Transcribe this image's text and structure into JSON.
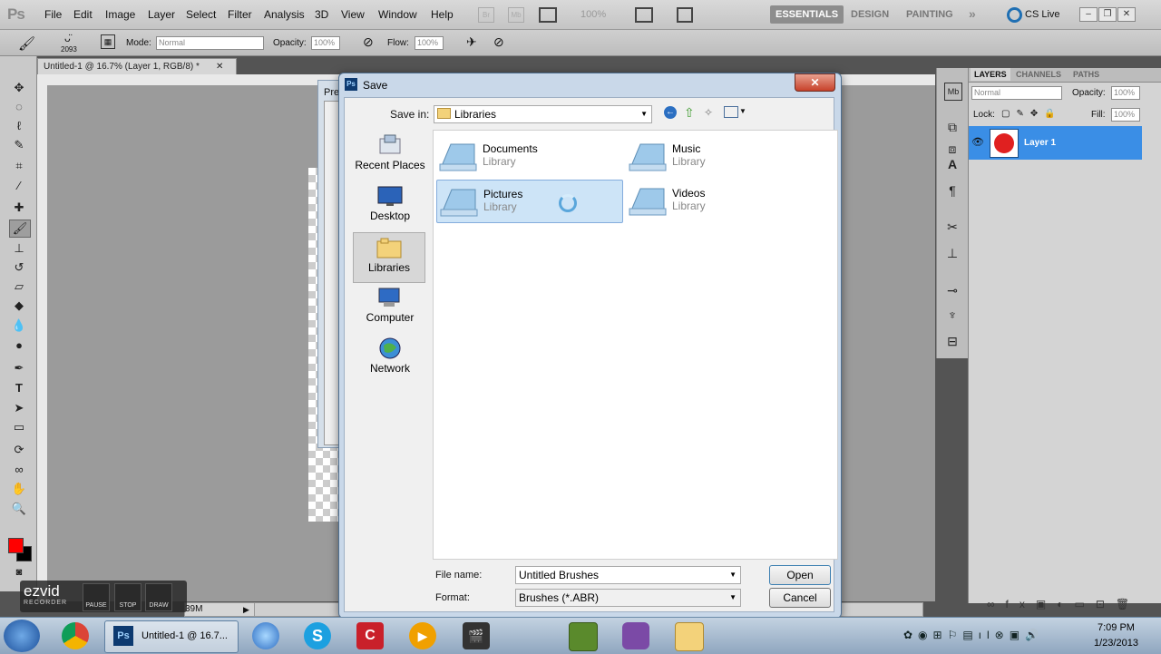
{
  "app": {
    "logo": "Ps",
    "menu": [
      "File",
      "Edit",
      "Image",
      "Layer",
      "Select",
      "Filter",
      "Analysis",
      "3D",
      "View",
      "Window",
      "Help"
    ],
    "zoom": "100%",
    "workspaces": [
      "ESSENTIALS",
      "DESIGN",
      "PAINTING"
    ],
    "cs_live": "CS Live"
  },
  "options_bar": {
    "brush_size": "2093",
    "mode_label": "Mode:",
    "mode_value": "Normal",
    "opacity_label": "Opacity:",
    "opacity_value": "100%",
    "flow_label": "Flow:",
    "flow_value": "100%"
  },
  "document": {
    "tab_title": "Untitled-1 @ 16.7% (Layer 1, RGB/8) *",
    "status": "39M",
    "background_dialog_title": "Pre"
  },
  "ezvid": {
    "logo": "ezvid",
    "sub": "RECORDER",
    "buttons": [
      "PAUSE",
      "STOP",
      "DRAW"
    ]
  },
  "layers_panel": {
    "tabs": [
      "LAYERS",
      "CHANNELS",
      "PATHS"
    ],
    "blend_mode": "Normal",
    "opacity_label": "Opacity:",
    "opacity_value": "100%",
    "lock_label": "Lock:",
    "fill_label": "Fill:",
    "fill_value": "100%",
    "layer_name": "Layer 1"
  },
  "dialog": {
    "title": "Save",
    "save_in_label": "Save in:",
    "save_in_value": "Libraries",
    "places": [
      "Recent Places",
      "Desktop",
      "Libraries",
      "Computer",
      "Network"
    ],
    "items": [
      {
        "name": "Documents",
        "kind": "Library"
      },
      {
        "name": "Music",
        "kind": "Library"
      },
      {
        "name": "Pictures",
        "kind": "Library"
      },
      {
        "name": "Videos",
        "kind": "Library"
      }
    ],
    "file_name_label": "File name:",
    "file_name_value": "Untitled Brushes",
    "format_label": "Format:",
    "format_value": "Brushes (*.ABR)",
    "open_button": "Open",
    "cancel_button": "Cancel"
  },
  "taskbar": {
    "active_window": "Untitled-1 @ 16.7...",
    "time": "7:09 PM",
    "date": "1/23/2013"
  },
  "colors": {
    "foreground": "#ff0000",
    "background": "#000000",
    "selection": "#3a8ee6"
  }
}
